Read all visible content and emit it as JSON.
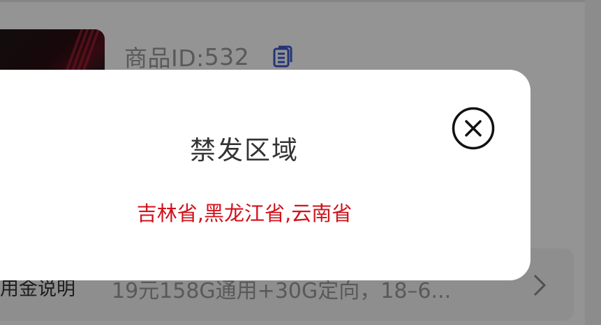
{
  "product": {
    "id_label": "商品ID:",
    "id_value": "532"
  },
  "info": {
    "label": "用金说明",
    "value": "19元158G通用+30G定向，18–6..."
  },
  "modal": {
    "title": "禁发区域",
    "content": "吉林省,黑龙江省,云南省"
  },
  "icons": {
    "copy": "copy-icon",
    "close": "close-circle-icon",
    "chevron": "chevron-right-icon"
  },
  "colors": {
    "restricted_text": "#d0121b",
    "copy_icon": "#3d5ad0",
    "overlay": "rgba(0,0,0,0.42)"
  }
}
